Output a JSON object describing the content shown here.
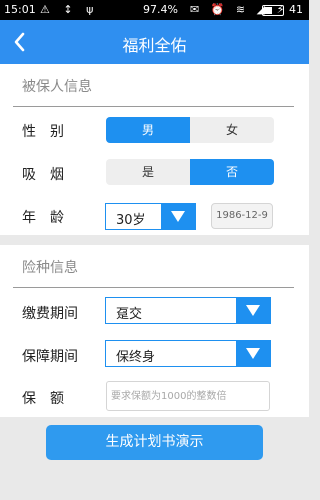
{
  "status_bar": {
    "time": "15:01",
    "left_icons": "⚠ ↕ ψ",
    "battery_percent": "97.4%",
    "right_icons": "✉ ⏰ ≋ ◢ ⚡",
    "battery_level": "41"
  },
  "header": {
    "title": "福利全佑",
    "back_icon": "chevron-left-icon"
  },
  "insured": {
    "section_title": "被保人信息",
    "gender": {
      "label": "性别",
      "options": [
        "男",
        "女"
      ],
      "selected": "男"
    },
    "smoking": {
      "label": "吸烟",
      "options": [
        "是",
        "否"
      ],
      "selected": "否"
    },
    "age": {
      "label": "年龄",
      "value": "30岁",
      "birthdate": "1986-12-9"
    }
  },
  "policy": {
    "section_title": "险种信息",
    "payment_period": {
      "label": "缴费期间",
      "value": "趸交"
    },
    "coverage_period": {
      "label": "保障期间",
      "value": "保终身"
    },
    "amount": {
      "label": "保额",
      "placeholder": "要求保额为1000的整数倍",
      "value": ""
    }
  },
  "submit_label": "生成计划书演示",
  "colors": {
    "accent": "#1e90f0",
    "header": "#2f8ff0",
    "button": "#2f9aef"
  }
}
